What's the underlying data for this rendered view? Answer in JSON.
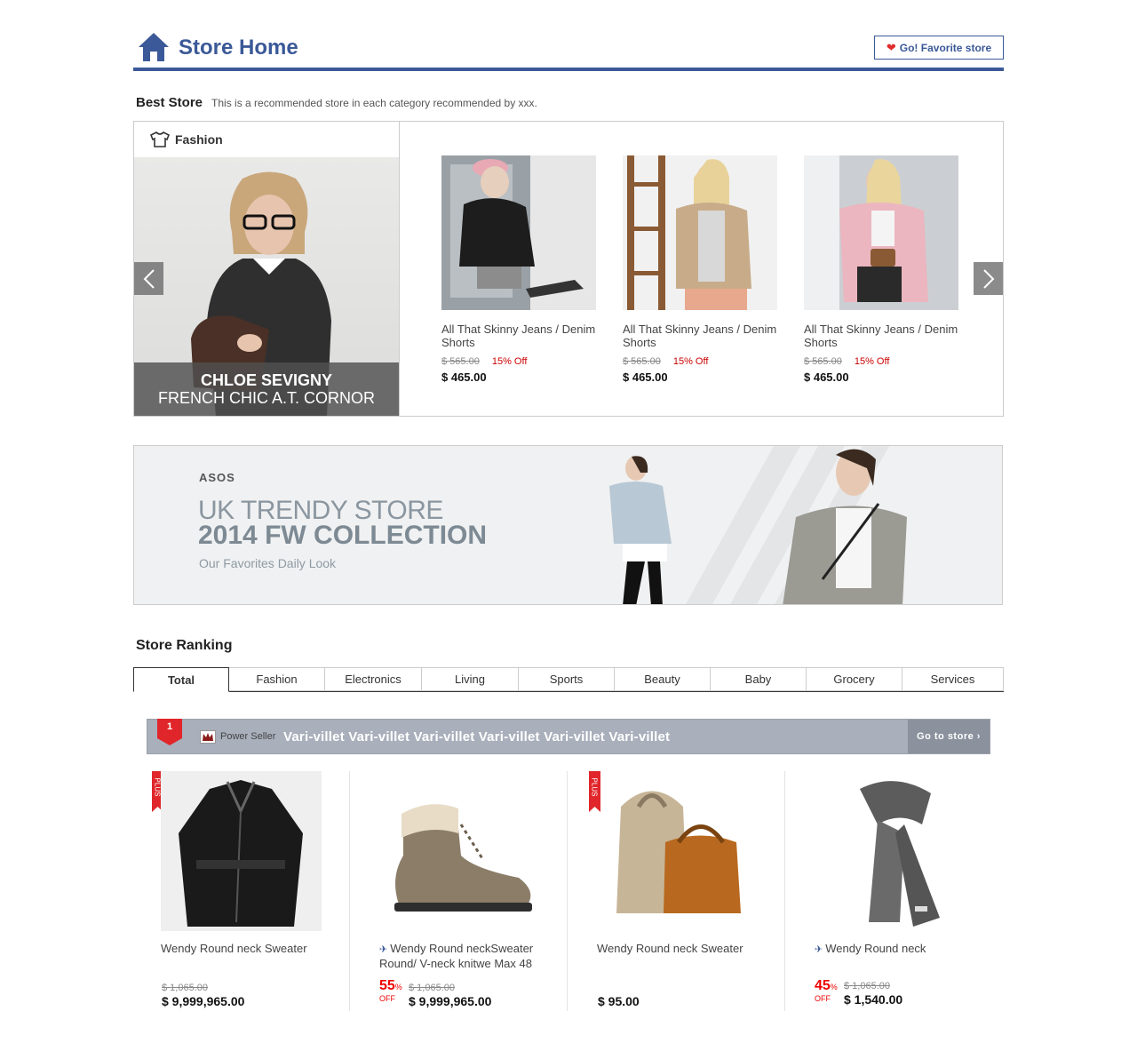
{
  "header": {
    "title": "Store Home",
    "fav_button": "Go! Favorite store",
    "colors": {
      "brand": "#3b5998",
      "heart": "#e02b2b"
    }
  },
  "best_store": {
    "title": "Best Store",
    "subtitle": "This is a recommended store in each category recommended by xxx.",
    "category": "Fashion",
    "hero_line1": "CHLOE SEVIGNY",
    "hero_line2": "FRENCH CHIC A.T. CORNOR",
    "products": [
      {
        "name": "All That Skinny Jeans / Denim Shorts",
        "old_price": "$ 565.00",
        "discount": "15% Off",
        "price": "$ 465.00"
      },
      {
        "name": "All That Skinny Jeans / Denim Shorts",
        "old_price": "$ 565.00",
        "discount": "15% Off",
        "price": "$ 465.00"
      },
      {
        "name": "All That Skinny Jeans / Denim Shorts",
        "old_price": "$ 565.00",
        "discount": "15% Off",
        "price": "$ 465.00"
      }
    ]
  },
  "banner": {
    "brand": "ASOS",
    "line1": "UK TRENDY STORE",
    "line2": "2014 FW COLLECTION",
    "line3": "Our Favorites Daily Look"
  },
  "ranking": {
    "title": "Store Ranking",
    "tabs": [
      "Total",
      "Fashion",
      "Electronics",
      "Living",
      "Sports",
      "Beauty",
      "Baby",
      "Grocery",
      "Services"
    ],
    "active_tab": "Total",
    "rank": "1",
    "seller_label": "Power Seller",
    "store_name": "Vari-villet Vari-villet Vari-villet Vari-villet Vari-villet Vari-villet",
    "go_store": "Go to store ›",
    "plus_label": "PLUS",
    "items": [
      {
        "name": "Wendy Round neck Sweater",
        "old_price": "$ 1,065.00",
        "price": "$ 9,999,965.00"
      },
      {
        "name": "Wendy Round neckSweater Round/ V-neck knitwe Max 48",
        "discount_pct": "55",
        "pct_sign": "%",
        "off": "OFF",
        "old_price": "$ 1,065.00",
        "price": "$ 9,999,965.00"
      },
      {
        "name": "Wendy Round neck Sweater",
        "price": "$ 95.00"
      },
      {
        "name": "Wendy Round neck",
        "discount_pct": "45",
        "pct_sign": "%",
        "off": "OFF",
        "old_price": "$ 1,065.00",
        "price": "$ 1,540.00"
      }
    ]
  }
}
